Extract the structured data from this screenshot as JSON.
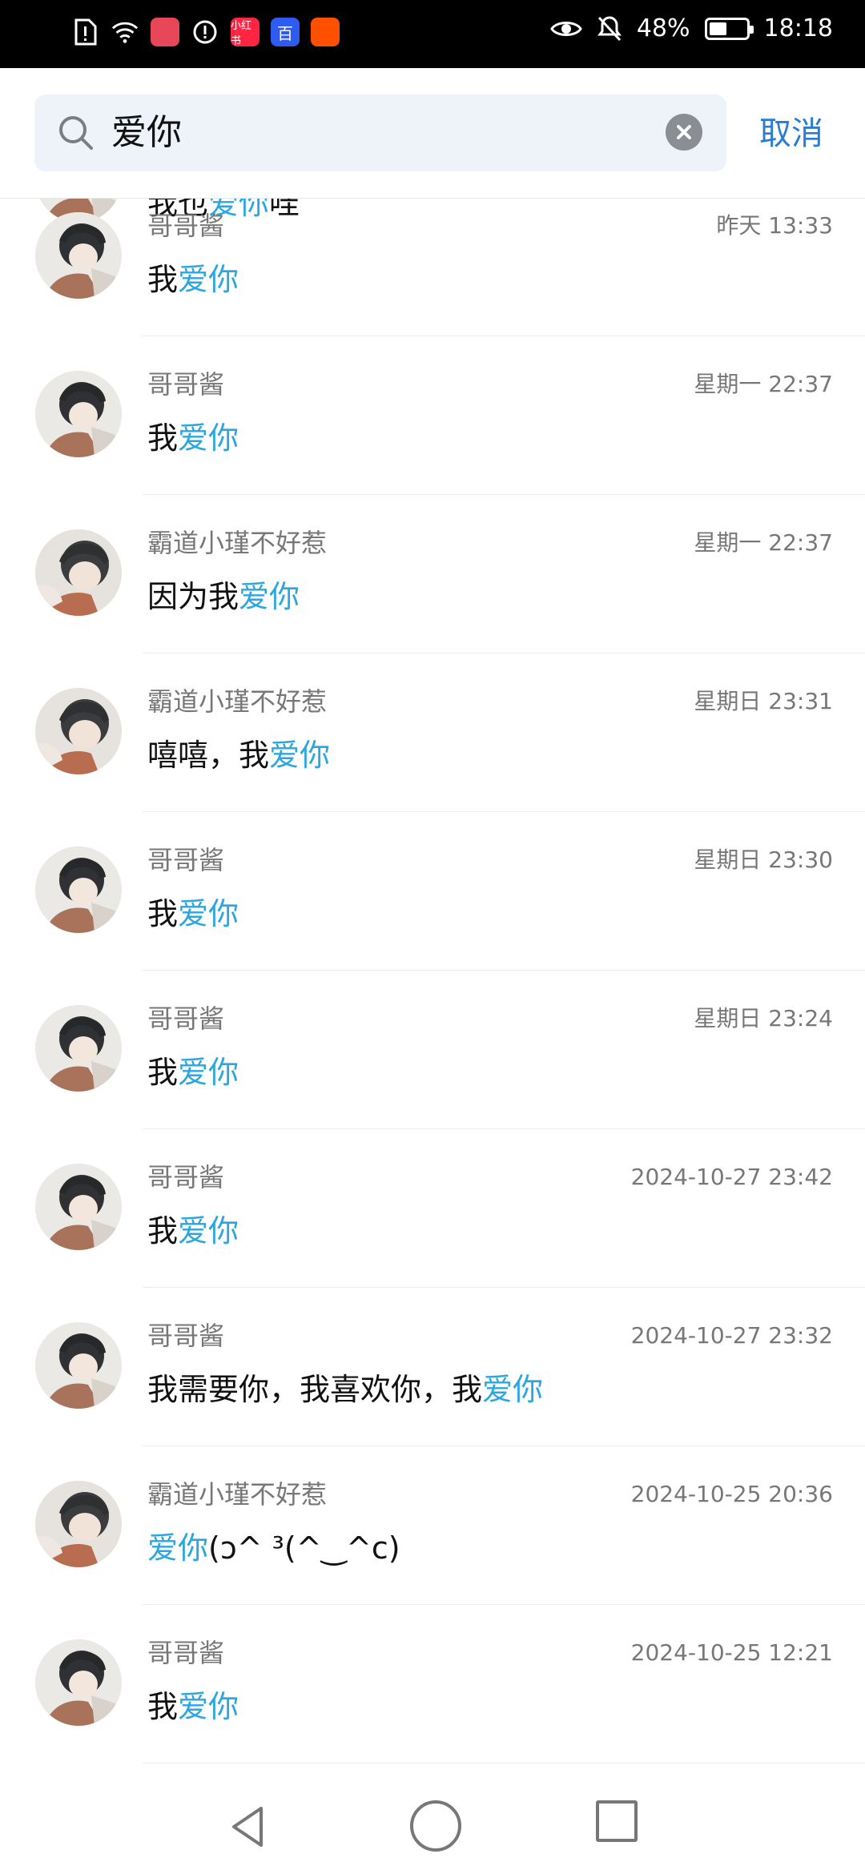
{
  "status_bar": {
    "battery": "48%",
    "time": "18:18",
    "battery_level": 0.48,
    "left_icons": [
      "sim-alert-icon",
      "wifi-icon",
      "huawei-app-icon",
      "alert-icon",
      "xiaohongshu-icon",
      "baidu-icon",
      "taobao-icon"
    ],
    "right_icons": [
      "eye-icon",
      "mute-icon",
      "battery-icon"
    ],
    "xiaohongshu_label": "小红书",
    "baidu_label": "百"
  },
  "search": {
    "query": "爱你",
    "cancel_label": "取消"
  },
  "colors": {
    "highlight": "#2aa6e0",
    "accent": "#2a7bd1"
  },
  "results": [
    {
      "avatar": "boy",
      "name": "",
      "time": "",
      "pre": "我也",
      "hit": "爱你",
      "post": "哇"
    },
    {
      "avatar": "boy",
      "name": "哥哥酱",
      "time": "昨天 13:33",
      "pre": "我",
      "hit": "爱你",
      "post": ""
    },
    {
      "avatar": "boy",
      "name": "哥哥酱",
      "time": "星期一 22:37",
      "pre": "我",
      "hit": "爱你",
      "post": ""
    },
    {
      "avatar": "girl",
      "name": "霸道小瑾不好惹",
      "time": "星期一 22:37",
      "pre": "因为我",
      "hit": "爱你",
      "post": ""
    },
    {
      "avatar": "girl",
      "name": "霸道小瑾不好惹",
      "time": "星期日 23:31",
      "pre": "嘻嘻，我",
      "hit": "爱你",
      "post": ""
    },
    {
      "avatar": "boy",
      "name": "哥哥酱",
      "time": "星期日 23:30",
      "pre": "我",
      "hit": "爱你",
      "post": ""
    },
    {
      "avatar": "boy",
      "name": "哥哥酱",
      "time": "星期日 23:24",
      "pre": "我",
      "hit": "爱你",
      "post": ""
    },
    {
      "avatar": "boy",
      "name": "哥哥酱",
      "time": "2024-10-27 23:42",
      "pre": "我",
      "hit": "爱你",
      "post": ""
    },
    {
      "avatar": "boy",
      "name": "哥哥酱",
      "time": "2024-10-27 23:32",
      "pre": "我需要你，我喜欢你，我",
      "hit": "爱你",
      "post": ""
    },
    {
      "avatar": "girl",
      "name": "霸道小瑾不好惹",
      "time": "2024-10-25 20:36",
      "pre": "",
      "hit": "爱你",
      "post": "(ɔ^ ³(^‿^c)"
    },
    {
      "avatar": "boy",
      "name": "哥哥酱",
      "time": "2024-10-25 12:21",
      "pre": "我",
      "hit": "爱你",
      "post": ""
    }
  ],
  "nav": {
    "icons": [
      "back-icon",
      "home-icon",
      "recent-apps-icon"
    ]
  }
}
